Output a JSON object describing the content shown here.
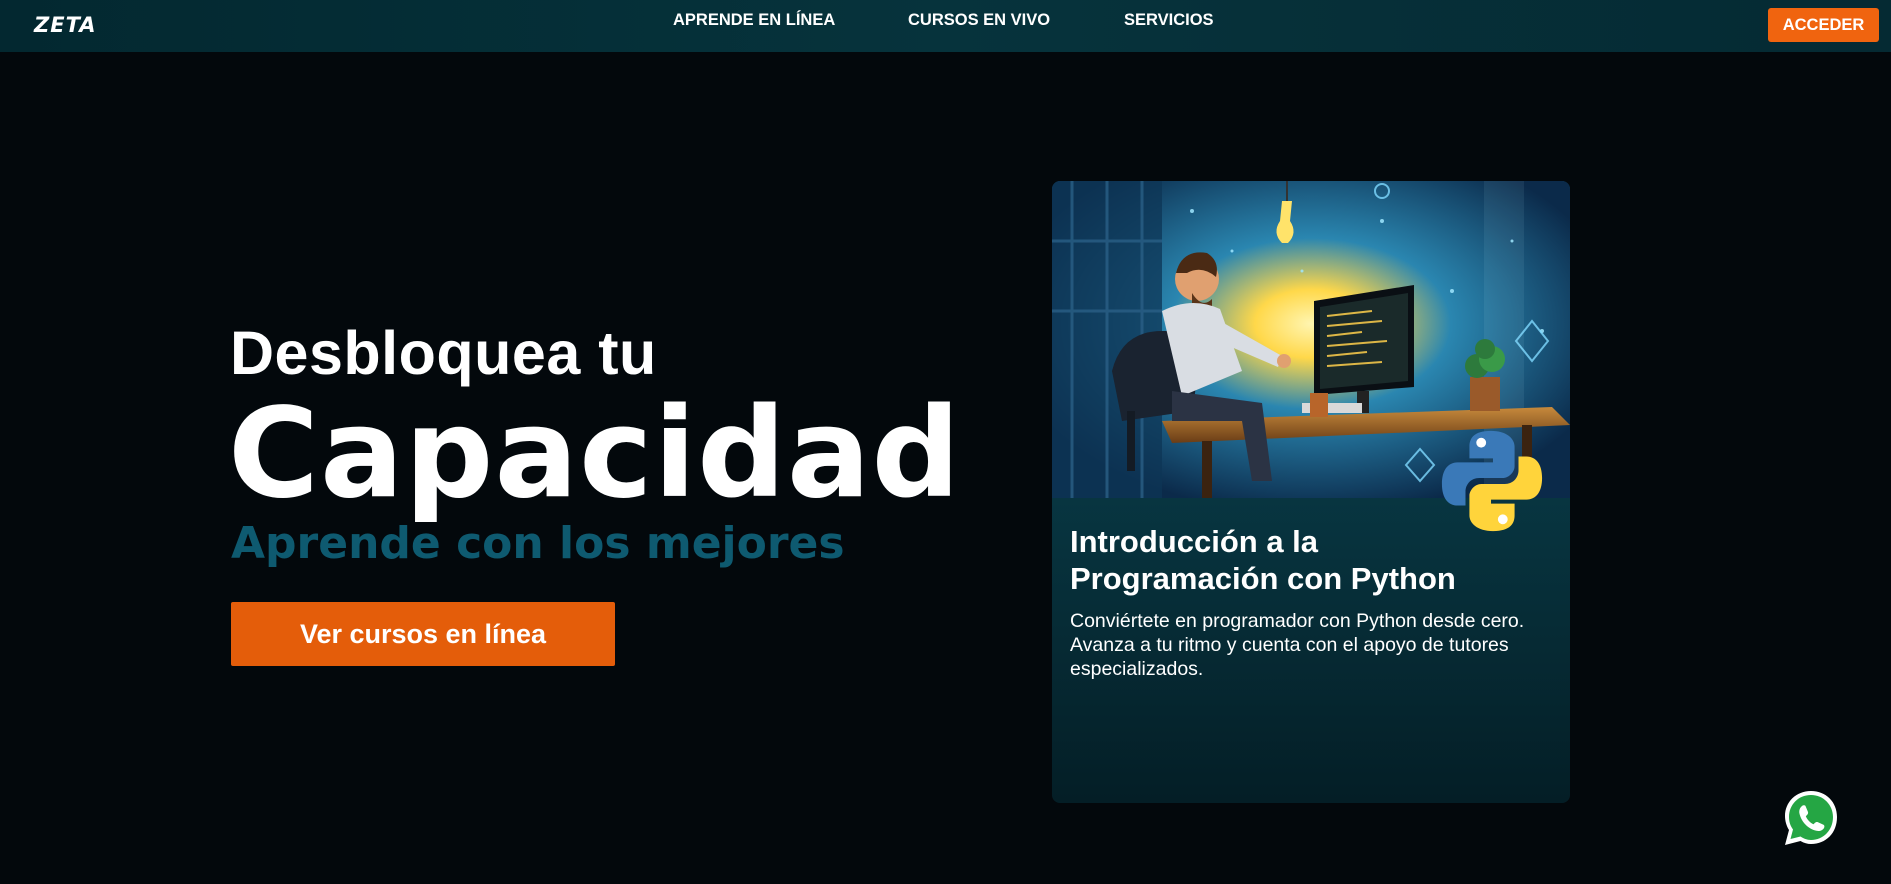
{
  "header": {
    "logo_text": "ZETA",
    "nav": [
      {
        "label": "APRENDE EN LÍNEA"
      },
      {
        "label": "CURSOS EN VIVO"
      },
      {
        "label": "SERVICIOS"
      }
    ],
    "login_label": "ACCEDER"
  },
  "hero": {
    "line1": "Desbloquea tu",
    "line2": "Capacidad",
    "line3": "Aprende con los mejores",
    "cta_label": "Ver cursos en línea"
  },
  "course_card": {
    "title": "Introducción a la Programación con Python",
    "description": "Conviértete en programador con Python desde cero. Avanza a tu ritmo y cuenta con el apoyo de tutores especializados.",
    "image_icon": "programmer-illustration",
    "badge_icon": "python-logo-icon"
  },
  "floating": {
    "icon": "whatsapp-icon"
  },
  "colors": {
    "accent_orange": "#f0640f",
    "heading_teal": "#0e5a70",
    "background": "#03080c",
    "nav_bg": "#06333c"
  }
}
